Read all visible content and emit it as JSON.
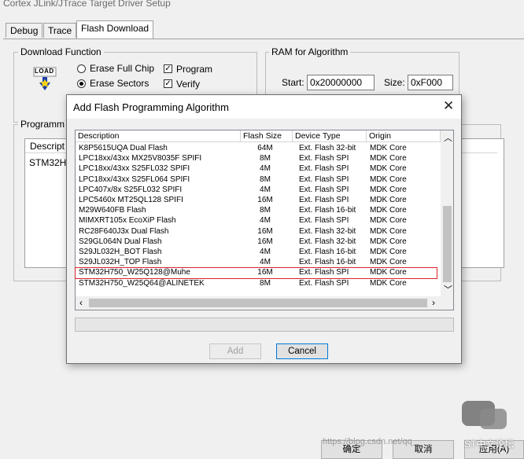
{
  "window": {
    "title": "Cortex JLink/JTrace Target Driver Setup"
  },
  "tabs": [
    {
      "label": "Debug"
    },
    {
      "label": "Trace"
    },
    {
      "label": "Flash Download"
    }
  ],
  "download_function": {
    "title": "Download Function",
    "load_icon_text": "LOAD",
    "options": {
      "erase_full_chip": "Erase Full Chip",
      "erase_sectors": "Erase Sectors",
      "program": "Program",
      "verify": "Verify"
    }
  },
  "ram": {
    "title": "RAM for Algorithm",
    "start_label": "Start:",
    "start_value": "0x20000000",
    "size_label": "Size:",
    "size_value": "0xF000"
  },
  "programming_algorithm": {
    "title": "Programm",
    "col_description": "Descript",
    "first_row": "STM32H"
  },
  "dialog": {
    "title": "Add Flash Programming Algorithm",
    "columns": [
      "Description",
      "Flash Size",
      "Device Type",
      "Origin"
    ],
    "rows": [
      {
        "description": "K8P5615UQA Dual Flash",
        "size": "64M",
        "type": "Ext. Flash 32-bit",
        "origin": "MDK Core"
      },
      {
        "description": "LPC18xx/43xx MX25V8035F SPIFI",
        "size": "8M",
        "type": "Ext. Flash SPI",
        "origin": "MDK Core"
      },
      {
        "description": "LPC18xx/43xx S25FL032 SPIFI",
        "size": "4M",
        "type": "Ext. Flash SPI",
        "origin": "MDK Core"
      },
      {
        "description": "LPC18xx/43xx S25FL064 SPIFI",
        "size": "8M",
        "type": "Ext. Flash SPI",
        "origin": "MDK Core"
      },
      {
        "description": "LPC407x/8x S25FL032 SPIFI",
        "size": "4M",
        "type": "Ext. Flash SPI",
        "origin": "MDK Core"
      },
      {
        "description": "LPC5460x MT25QL128 SPIFI",
        "size": "16M",
        "type": "Ext. Flash SPI",
        "origin": "MDK Core"
      },
      {
        "description": "M29W640FB Flash",
        "size": "8M",
        "type": "Ext. Flash 16-bit",
        "origin": "MDK Core"
      },
      {
        "description": "MIMXRT105x EcoXiP Flash",
        "size": "4M",
        "type": "Ext. Flash SPI",
        "origin": "MDK Core"
      },
      {
        "description": "RC28F640J3x Dual Flash",
        "size": "16M",
        "type": "Ext. Flash 32-bit",
        "origin": "MDK Core"
      },
      {
        "description": "S29GL064N Dual Flash",
        "size": "16M",
        "type": "Ext. Flash 32-bit",
        "origin": "MDK Core"
      },
      {
        "description": "S29JL032H_BOT Flash",
        "size": "4M",
        "type": "Ext. Flash 16-bit",
        "origin": "MDK Core"
      },
      {
        "description": "S29JL032H_TOP Flash",
        "size": "4M",
        "type": "Ext. Flash 16-bit",
        "origin": "MDK Core"
      },
      {
        "description": "STM32H750_W25Q128@Muhe",
        "size": "16M",
        "type": "Ext. Flash SPI",
        "origin": "MDK Core"
      },
      {
        "description": "STM32H750_W25Q64@ALINETEK",
        "size": "8M",
        "type": "Ext. Flash SPI",
        "origin": "MDK Core"
      }
    ],
    "highlight_color": "#d9232c",
    "add_button": "Add",
    "cancel_button": "Cancel"
  },
  "footer": {
    "ok_button": "确定",
    "cancel_button": "取消",
    "apply_button": "应用(A)",
    "watermark": "https://blog.csdn.net/qq_",
    "watermark_brand": "ST中文论坛"
  }
}
